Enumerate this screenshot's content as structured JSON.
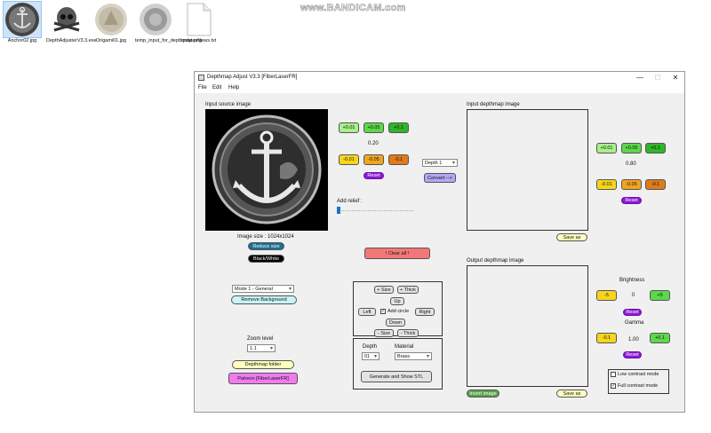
{
  "desktop": {
    "watermark": "www.BANDICAM.com",
    "icons": [
      {
        "label": "Anchor02.jpg",
        "icon": "image-thumbnail-anchor"
      },
      {
        "label": "DepthAdjusterV3.3.exe",
        "icon": "skull-app-icon"
      },
      {
        "label": "Origami01.jpg",
        "icon": "image-thumbnail-origami"
      },
      {
        "label": "temp_input_for_depthmap.png",
        "icon": "image-thumbnail-coin"
      },
      {
        "label": "updatesNews.txt",
        "icon": "text-file-icon"
      }
    ]
  },
  "window": {
    "title": "Depthmap Adjust V3.3 [FiberLaserFR]",
    "controls": {
      "minimize": "—",
      "maximize": "☐",
      "close": "✕"
    },
    "menu": [
      "File",
      "Edit",
      "Help"
    ]
  },
  "source": {
    "label": "Input source image",
    "image_size": "Image size : 1024x1024",
    "reduce_size": "Reduce size",
    "black_white": "Black/White",
    "mode_select": "Mode 1 - General",
    "remove_bg": "Remove Background",
    "zoom_label": "Zoom level",
    "zoom_value": "1.1",
    "depthmap_folder": "Depthmap folder",
    "patreon": "Patreon [FiberLaserFR]"
  },
  "adjust": {
    "plus_buttons": [
      "+0.01",
      "+0.05",
      "+0.1"
    ],
    "value": "0.20",
    "minus_buttons": [
      "-0.01",
      "-0.05",
      "-0.1"
    ],
    "reset": "Reset",
    "depth_select": "Depth 1",
    "convert": "Convert -->",
    "relief_label": "Add relief :",
    "relief_value": 0,
    "clear_all": "!   Clear all   !"
  },
  "shape": {
    "plus_size": "+ Size",
    "plus_thick": "+ Thick",
    "up": "Up",
    "left": "Left",
    "add_circle": "Add circle",
    "add_circle_checked": true,
    "right": "Right",
    "down": "Down",
    "minus_size": "- Size",
    "minus_thick": "- Thick",
    "depth_label": "Depth",
    "depth_value": "01",
    "material_label": "Material",
    "material_value": "Brass",
    "generate": "Generate and Show STL"
  },
  "input_depthmap": {
    "label": "Input depthmap image",
    "save_as": "Save as",
    "plus_buttons": [
      "+0.01",
      "+0.05",
      "+0.1"
    ],
    "value": "0.80",
    "minus_buttons": [
      "-0.01",
      "-0.05",
      "-0.1"
    ],
    "reset": "Reset"
  },
  "output_depthmap": {
    "label": "Output depthmap image",
    "invert": "Invert image",
    "save_as": "Save as",
    "brightness_label": "Brightness",
    "brightness_minus": "-5",
    "brightness_value": "0",
    "brightness_plus": "+5",
    "brightness_reset": "Reset",
    "gamma_label": "Gamma",
    "gamma_minus": "-0.1",
    "gamma_value": "1.00",
    "gamma_plus": "+0.1",
    "gamma_reset": "Reset",
    "low_contrast": "Low contrast mode",
    "low_contrast_checked": false,
    "full_contrast": "Full contrast mode",
    "full_contrast_checked": true
  },
  "colors": {
    "green_light": "#a7f08a",
    "green_mid": "#5cd84a",
    "green_dark": "#2fb52a",
    "yellow": "#f7d51c",
    "orange": "#f0a51e",
    "orange_dark": "#e07b1a",
    "purple": "#8a1bd1",
    "clear_red": "#f27777"
  }
}
